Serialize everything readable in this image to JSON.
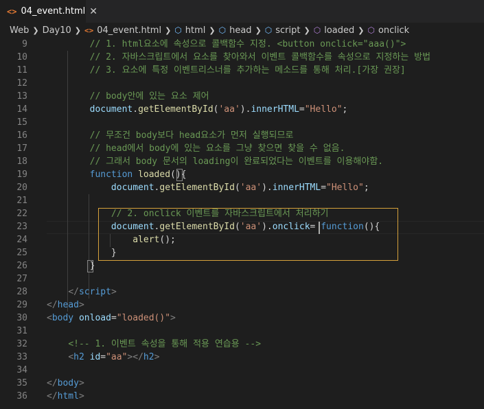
{
  "tab": {
    "icon": "<>",
    "title": "04_event.html",
    "close": "✕"
  },
  "breadcrumb": {
    "items": [
      "Web",
      "Day10",
      "04_event.html",
      "html",
      "head",
      "script",
      "loaded",
      "onclick"
    ],
    "file_icon": "<>"
  },
  "lines": [
    {
      "n": "9",
      "tokens": [
        [
          "c-com",
          "// 1. html요소에 속성으로 콜백함수 지정. <button onclick=\"aaa()\">"
        ]
      ],
      "indent": "        "
    },
    {
      "n": "10",
      "tokens": [
        [
          "c-com",
          "// 2. 자바스크립트에서 요소를 찾아와서 이벤트 콜백함수를 속성으로 지정하는 방법"
        ]
      ],
      "indent": "        "
    },
    {
      "n": "11",
      "tokens": [
        [
          "c-com",
          "// 3. 요소에 특정 이벤트리스너를 추가하는 메소드를 통해 처리.[가장 권장]"
        ]
      ],
      "indent": "        "
    },
    {
      "n": "12",
      "tokens": [],
      "indent": ""
    },
    {
      "n": "13",
      "tokens": [
        [
          "c-com",
          "// body안에 있는 요소 제어"
        ]
      ],
      "indent": "        "
    },
    {
      "n": "14",
      "tokens": [
        [
          "c-var",
          "document"
        ],
        [
          "c-pun",
          "."
        ],
        [
          "c-fn",
          "getElementById"
        ],
        [
          "c-pun",
          "("
        ],
        [
          "c-str",
          "'aa'"
        ],
        [
          "c-pun",
          ")."
        ],
        [
          "c-var",
          "innerHTML"
        ],
        [
          "c-pun",
          "="
        ],
        [
          "c-str",
          "\"Hello\""
        ],
        [
          "c-pun",
          ";"
        ]
      ],
      "indent": "        "
    },
    {
      "n": "15",
      "tokens": [],
      "indent": ""
    },
    {
      "n": "16",
      "tokens": [
        [
          "c-com",
          "// 무조건 body보다 head요소가 먼저 실행되므로"
        ]
      ],
      "indent": "        "
    },
    {
      "n": "17",
      "tokens": [
        [
          "c-com",
          "// head에서 body에 있는 요소를 그냥 찾으면 찾을 수 없음."
        ]
      ],
      "indent": "        "
    },
    {
      "n": "18",
      "tokens": [
        [
          "c-com",
          "// 그래서 body 문서의 loading이 완료되었다는 이벤트를 이용해야함."
        ]
      ],
      "indent": "        "
    },
    {
      "n": "19",
      "tokens": [
        [
          "c-kw",
          "function"
        ],
        [
          "c-pun",
          " "
        ],
        [
          "c-fn",
          "loaded"
        ],
        [
          "c-pun",
          "(){"
        ]
      ],
      "indent": "        "
    },
    {
      "n": "20",
      "tokens": [
        [
          "c-var",
          "document"
        ],
        [
          "c-pun",
          "."
        ],
        [
          "c-fn",
          "getElementById"
        ],
        [
          "c-pun",
          "("
        ],
        [
          "c-str",
          "'aa'"
        ],
        [
          "c-pun",
          ")."
        ],
        [
          "c-var",
          "innerHTML"
        ],
        [
          "c-pun",
          "="
        ],
        [
          "c-str",
          "\"Hello\""
        ],
        [
          "c-pun",
          ";"
        ]
      ],
      "indent": "            "
    },
    {
      "n": "21",
      "tokens": [],
      "indent": ""
    },
    {
      "n": "22",
      "tokens": [
        [
          "c-com",
          "// 2. onclick 이벤트를 자바스크립트에서 처리하기"
        ]
      ],
      "indent": "            "
    },
    {
      "n": "23",
      "tokens": [
        [
          "c-var",
          "document"
        ],
        [
          "c-pun",
          "."
        ],
        [
          "c-fn",
          "getElementById"
        ],
        [
          "c-pun",
          "("
        ],
        [
          "c-str",
          "'aa'"
        ],
        [
          "c-pun",
          ")."
        ],
        [
          "c-var",
          "onclick"
        ],
        [
          "c-pun",
          "= "
        ],
        [
          "c-kw",
          "function"
        ],
        [
          "c-pun",
          "(){"
        ]
      ],
      "indent": "            "
    },
    {
      "n": "24",
      "tokens": [
        [
          "c-fn",
          "alert"
        ],
        [
          "c-pun",
          "();"
        ]
      ],
      "indent": "                "
    },
    {
      "n": "25",
      "tokens": [
        [
          "c-pun",
          "}"
        ]
      ],
      "indent": "            "
    },
    {
      "n": "26",
      "tokens": [
        [
          "c-pun",
          "}"
        ]
      ],
      "indent": "        "
    },
    {
      "n": "27",
      "tokens": [],
      "indent": ""
    },
    {
      "n": "28",
      "tokens": [
        [
          "c-gray",
          "</"
        ],
        [
          "c-tag",
          "script"
        ],
        [
          "c-gray",
          ">"
        ]
      ],
      "indent": "    "
    },
    {
      "n": "29",
      "tokens": [
        [
          "c-gray",
          "</"
        ],
        [
          "c-tag",
          "head"
        ],
        [
          "c-gray",
          ">"
        ]
      ],
      "indent": ""
    },
    {
      "n": "30",
      "tokens": [
        [
          "c-gray",
          "<"
        ],
        [
          "c-tag",
          "body"
        ],
        [
          "c-pun",
          " "
        ],
        [
          "c-attr",
          "onload"
        ],
        [
          "c-pun",
          "="
        ],
        [
          "c-str",
          "\"loaded()\""
        ],
        [
          "c-gray",
          ">"
        ]
      ],
      "indent": ""
    },
    {
      "n": "31",
      "tokens": [],
      "indent": ""
    },
    {
      "n": "32",
      "tokens": [
        [
          "c-com",
          "<!-- 1. 이벤트 속성을 통해 적용 연습용 -->"
        ]
      ],
      "indent": "    "
    },
    {
      "n": "33",
      "tokens": [
        [
          "c-gray",
          "<"
        ],
        [
          "c-tag",
          "h2"
        ],
        [
          "c-pun",
          " "
        ],
        [
          "c-attr",
          "id"
        ],
        [
          "c-pun",
          "="
        ],
        [
          "c-str",
          "\"aa\""
        ],
        [
          "c-gray",
          "></"
        ],
        [
          "c-tag",
          "h2"
        ],
        [
          "c-gray",
          ">"
        ]
      ],
      "indent": "    "
    },
    {
      "n": "34",
      "tokens": [],
      "indent": ""
    },
    {
      "n": "35",
      "tokens": [
        [
          "c-gray",
          "</"
        ],
        [
          "c-tag",
          "body"
        ],
        [
          "c-gray",
          ">"
        ]
      ],
      "indent": ""
    },
    {
      "n": "36",
      "tokens": [
        [
          "c-gray",
          "</"
        ],
        [
          "c-tag",
          "html"
        ],
        [
          "c-gray",
          ">"
        ]
      ],
      "indent": ""
    }
  ]
}
